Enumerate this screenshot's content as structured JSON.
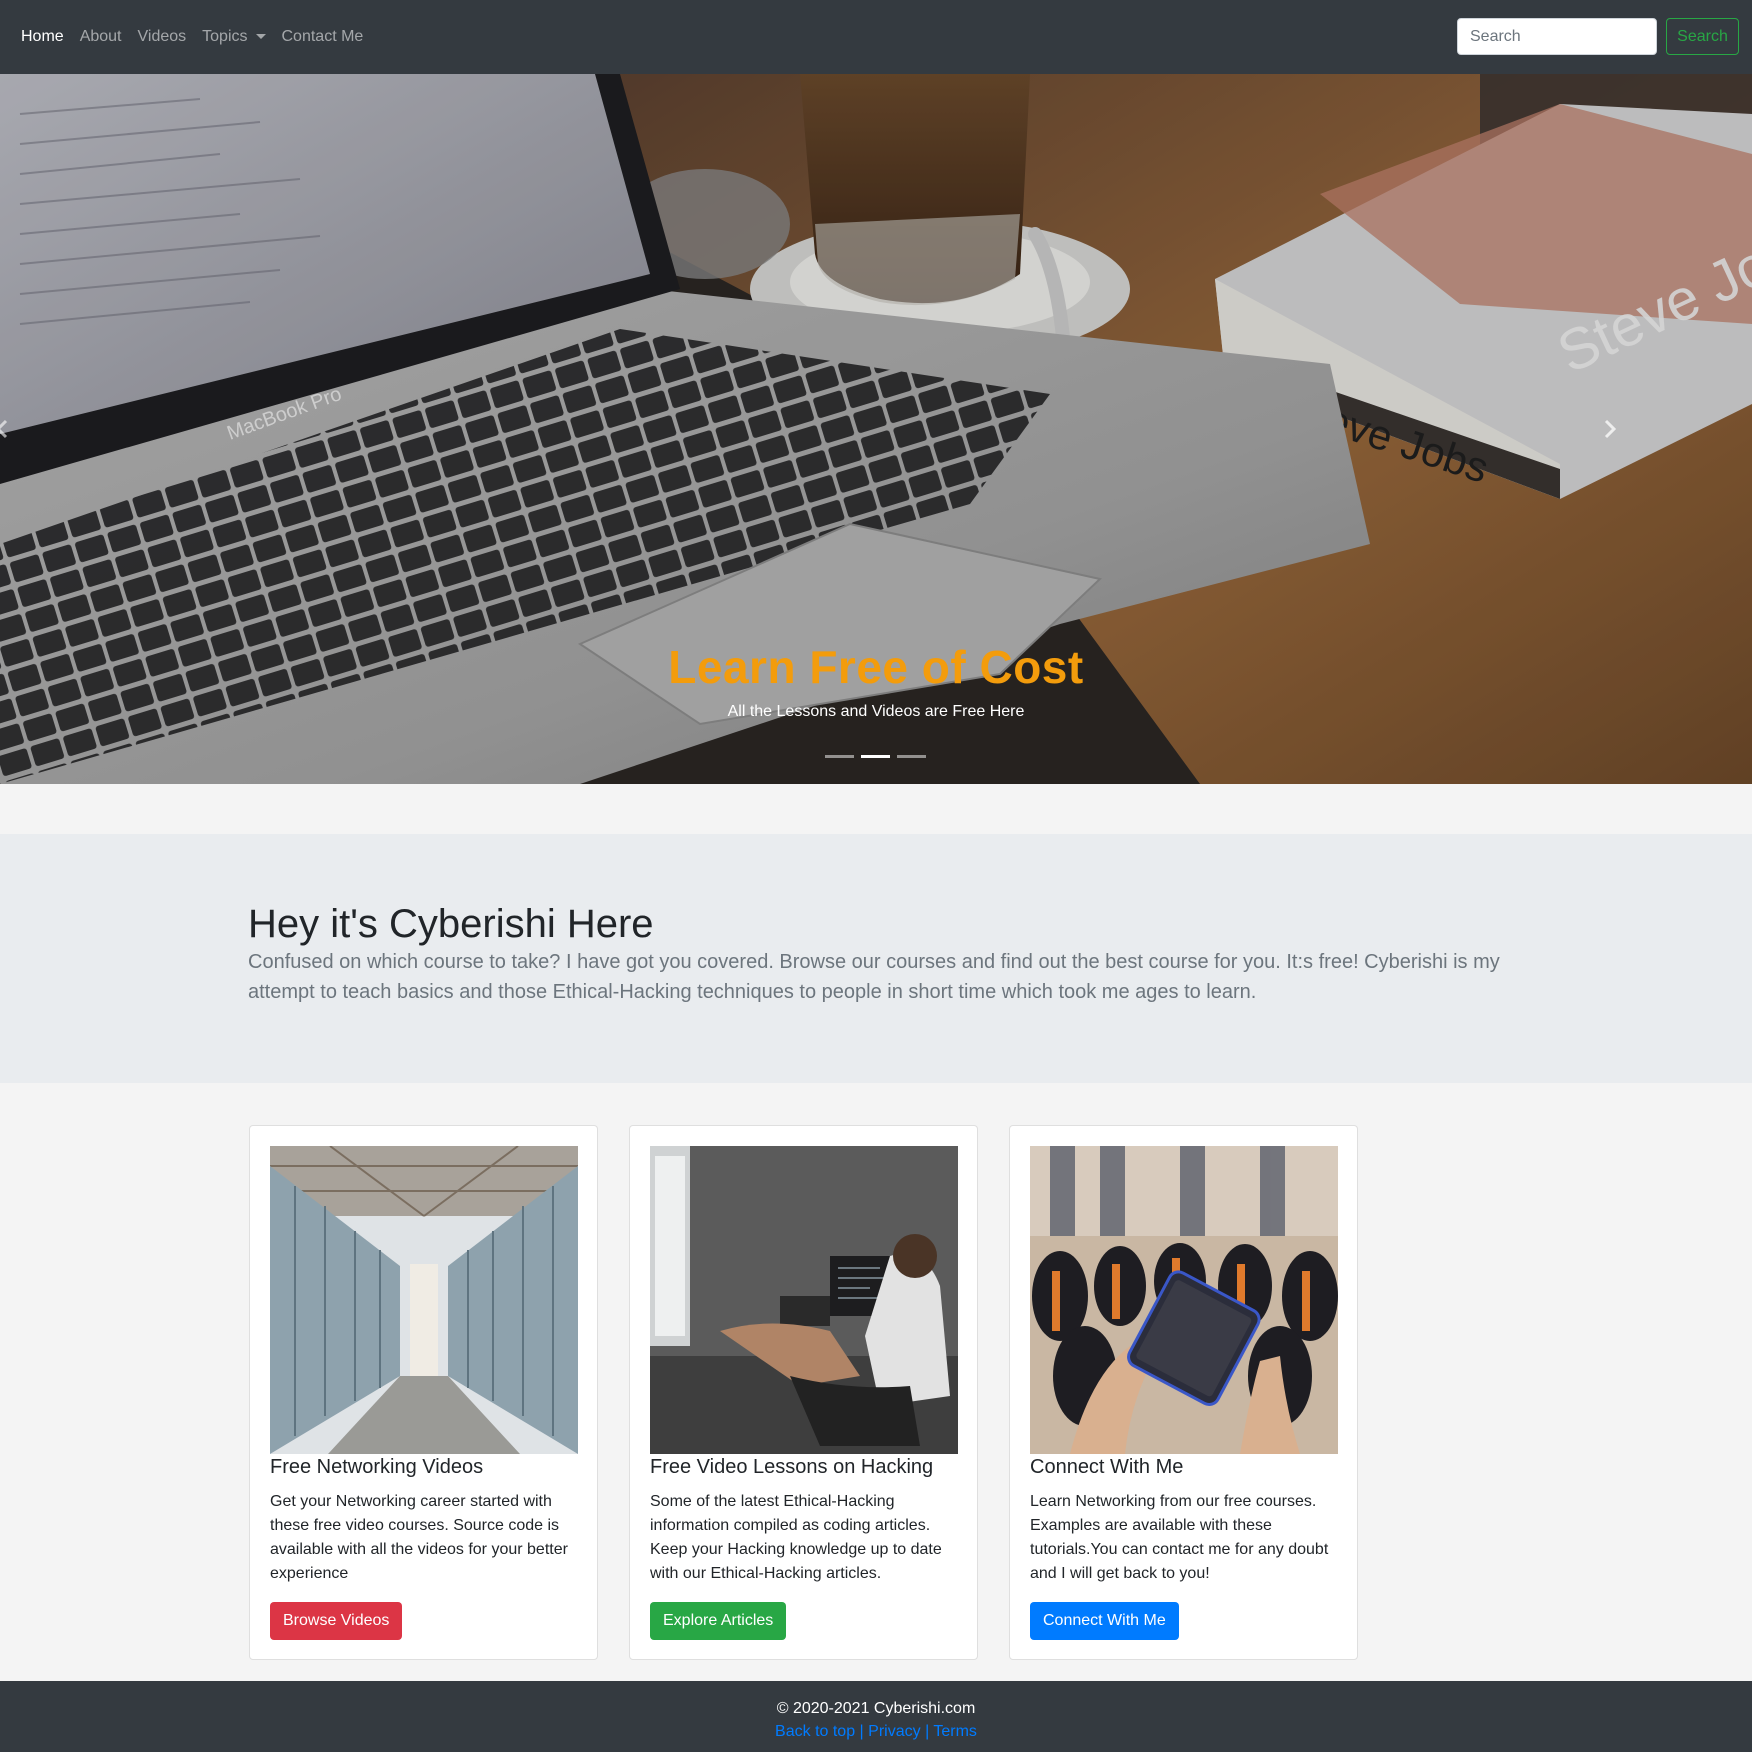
{
  "nav": {
    "items": [
      {
        "label": "Home",
        "active": true
      },
      {
        "label": "About",
        "active": false
      },
      {
        "label": "Videos",
        "active": false
      },
      {
        "label": "Topics",
        "active": false,
        "dropdown": true
      },
      {
        "label": "Contact Me",
        "active": false
      }
    ],
    "search_placeholder": "Search",
    "search_button": "Search"
  },
  "carousel": {
    "title": "Learn Free of Cost",
    "subtitle": "All the Lessons and Videos are Free Here",
    "slide_count": 3,
    "active_slide": 2,
    "photo_text": {
      "laptop_brand": "MacBook Pro",
      "book_title": "Steve Jobs",
      "book_cover_text": "Steve Jobs"
    }
  },
  "intro": {
    "heading": "Hey it's Cyberishi Here",
    "lead": "Confused on which course to take? I have got you covered. Browse our courses and find out the best course for you. It:s free! Cyberishi is my attempt to teach basics and those Ethical-Hacking techniques to people in short time which took me ages to learn."
  },
  "cards": [
    {
      "title": "Free Networking Videos",
      "text": "Get your Networking career started with these free video courses. Source code is available with all the videos for your better experience",
      "button": "Browse Videos",
      "button_color": "#dc3545",
      "image": "server-room-photo"
    },
    {
      "title": "Free Video Lessons on Hacking",
      "text": "Some of the latest Ethical-Hacking information compiled as coding articles. Keep your Hacking knowledge up to date with our Ethical-Hacking articles.",
      "button": "Explore Articles",
      "button_color": "#28a745",
      "image": "coder-at-desk-photo"
    },
    {
      "title": "Connect With Me",
      "text": "Learn Networking from our free courses. Examples are available with these tutorials.You can contact me for any doubt and I will get back to you!",
      "button": "Connect With Me",
      "button_color": "#007bff",
      "image": "phone-graduation-photo"
    }
  ],
  "footer": {
    "copyright": "© 2020-2021 Cyberishi.com",
    "links": [
      "Back to top",
      "Privacy",
      "Terms"
    ],
    "separator": "|"
  },
  "colors": {
    "navbar": "#343a40",
    "accent": "#f39c0c",
    "success": "#28a745",
    "danger": "#dc3545",
    "primary": "#007bff",
    "jumbotron": "#e9ecef"
  }
}
